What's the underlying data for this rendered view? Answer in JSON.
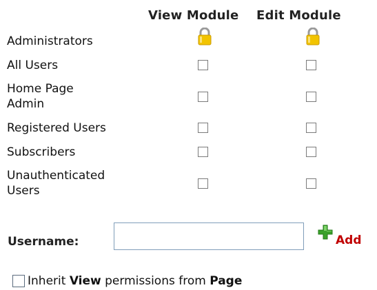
{
  "columns": {
    "view": "View Module",
    "edit": "Edit Module"
  },
  "roles": [
    {
      "line1": "Administrators",
      "line2": "",
      "view": "locked",
      "edit": "locked"
    },
    {
      "line1": "All Users",
      "line2": "",
      "view": "unchecked",
      "edit": "unchecked"
    },
    {
      "line1": "Home Page",
      "line2": "Admin",
      "view": "unchecked",
      "edit": "unchecked"
    },
    {
      "line1": "Registered Users",
      "line2": "",
      "view": "unchecked",
      "edit": "unchecked"
    },
    {
      "line1": "Subscribers",
      "line2": "",
      "view": "unchecked",
      "edit": "unchecked"
    },
    {
      "line1": "Unauthenticated",
      "line2": "Users",
      "view": "unchecked",
      "edit": "unchecked"
    }
  ],
  "username": {
    "label": "Username:",
    "value": "",
    "add_label": "Add"
  },
  "inherit": {
    "prefix": "Inherit ",
    "bold_view": "View",
    "middle": " permissions from ",
    "bold_page": "Page",
    "checked": false
  },
  "colors": {
    "add_label": "#c00000",
    "add_icon": "#3aa12a",
    "lock_body": "#f2c400",
    "lock_shackle": "#9a9a9a",
    "checkbox_border": "#7a7a7a",
    "input_border": "#7f9db9"
  },
  "icons": {
    "locked": "lock-icon",
    "add": "plus-icon"
  }
}
